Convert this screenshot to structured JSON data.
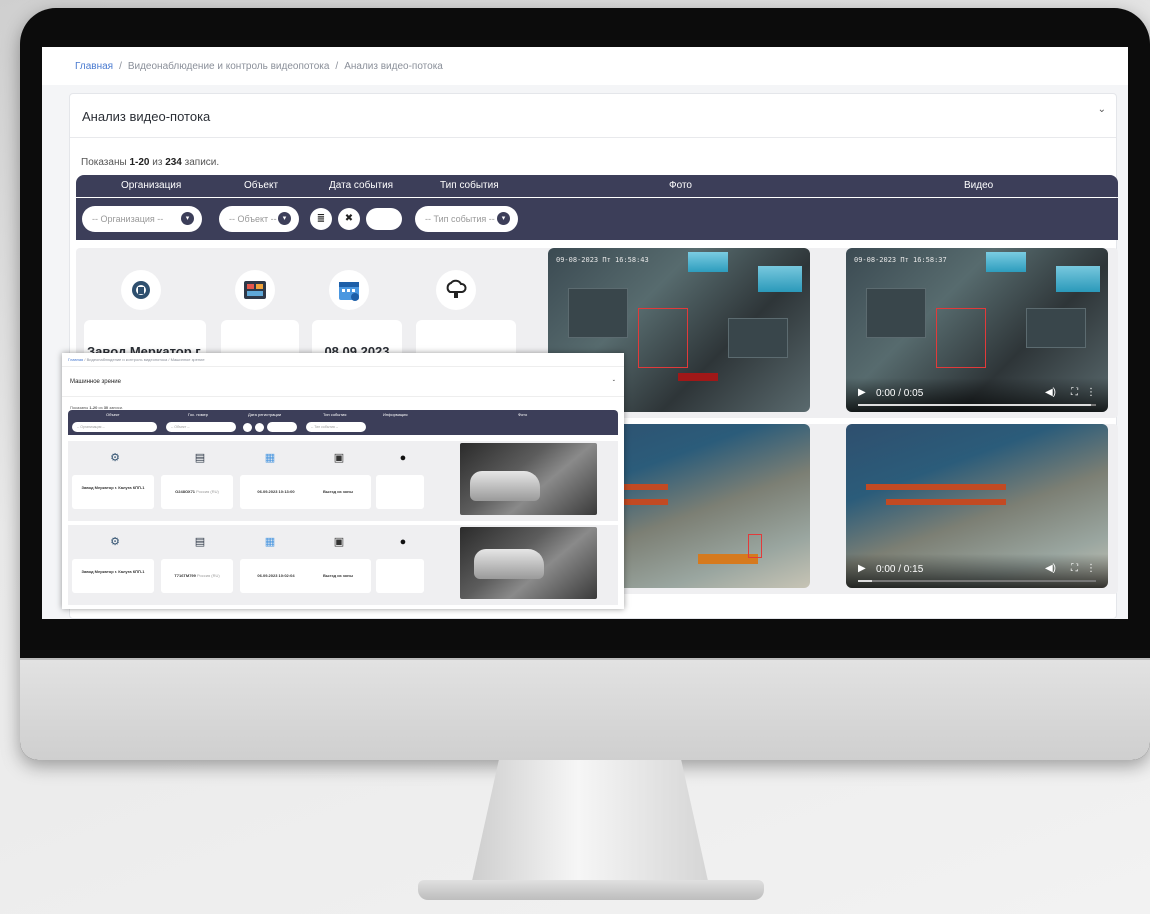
{
  "breadcrumb": {
    "home": "Главная",
    "section": "Видеонаблюдение и контроль видеопотока",
    "current": "Анализ видео-потока",
    "sep": "/"
  },
  "panel": {
    "title": "Анализ видео-потока",
    "chevron": "⌄",
    "shown_prefix": "Показаны ",
    "shown_range": "1-20",
    "shown_mid": " из ",
    "shown_total": "234",
    "shown_suffix": " записи."
  },
  "table": {
    "columns": [
      "Организация",
      "Объект",
      "Дата события",
      "Тип события",
      "Фото",
      "Видео"
    ]
  },
  "filters": {
    "organization": "-- Организация --",
    "object": "-- Объект --",
    "event_type": "-- Тип события --",
    "filter_icon": "≣",
    "clear_icon": "✖"
  },
  "rows": [
    {
      "organization": "Завод Меркатор г.",
      "object": "",
      "date": "08.09.2023",
      "event_type": "",
      "photo_timestamp": "09-08-2023 Пт 16:58:43",
      "video_timestamp": "09-08-2023 Пт 16:58:37",
      "video_time": "0:00 / 0:05",
      "video_progress": 0.98
    },
    {
      "video_time": "0:00 / 0:15",
      "video_progress": 0.06
    }
  ],
  "icons": {
    "organization": "gear-building-icon",
    "object": "object-card-icon",
    "date": "calendar-icon",
    "event_type": "cloud-lightbulb-icon",
    "play": "▶",
    "volume": "🔊",
    "fullscreen": "⛶",
    "more": "⋮"
  },
  "inset": {
    "breadcrumb_home": "Главная",
    "breadcrumb_section": "Видеонаблюдение и контроль видеопотока",
    "breadcrumb_current": "Машинное зрение",
    "title": "Машинное зрение",
    "shown_prefix": "Показаны ",
    "shown_range": "1-20",
    "shown_mid": " из ",
    "shown_total": "30",
    "shown_suffix": " записи.",
    "columns": [
      "Объект",
      "Гос. номер",
      "Дата регистрации",
      "Тип события",
      "Информация",
      "Фото"
    ],
    "filter_object": "-- Организация --",
    "filter_plate": "-- Объект --",
    "filter_type": "-- Тип события --",
    "rows": [
      {
        "object": "Завод Меркатор г. Калуга КПП-1",
        "plate": "О248ОХ71",
        "plate_region": "Россия (RU)",
        "date": "06.09.2023 10:13:00",
        "event_type": "Выезд из зоны"
      },
      {
        "object": "Завод Меркатор г. Калуга КПП-1",
        "plate": "Т716ТМ799",
        "plate_region": "Россия (RU)",
        "date": "06.09.2023 10:02:04",
        "event_type": "Выезд из зоны"
      }
    ]
  }
}
